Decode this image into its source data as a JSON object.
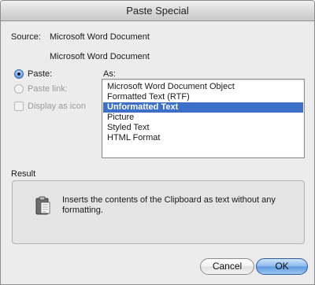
{
  "window": {
    "title": "Paste Special"
  },
  "source": {
    "label": "Source:",
    "value": "Microsoft Word Document",
    "detail": "Microsoft Word Document"
  },
  "options": {
    "paste_label": "Paste:",
    "paste_selected": true,
    "paste_link_label": "Paste link:",
    "display_as_icon_label": "Display as icon"
  },
  "as": {
    "label": "As:",
    "items": [
      "Microsoft Word Document Object",
      "Formatted Text (RTF)",
      "Unformatted Text",
      "Picture",
      "Styled Text",
      "HTML Format"
    ],
    "selected": "Unformatted Text"
  },
  "result": {
    "label": "Result",
    "icon": "clipboard-icon",
    "line1": "Inserts the contents of the Clipboard as text without any",
    "line2": "formatting."
  },
  "buttons": {
    "cancel": "Cancel",
    "ok": "OK"
  },
  "colors": {
    "selection": "#3b6fc8",
    "default_button": "#5d99e0"
  }
}
